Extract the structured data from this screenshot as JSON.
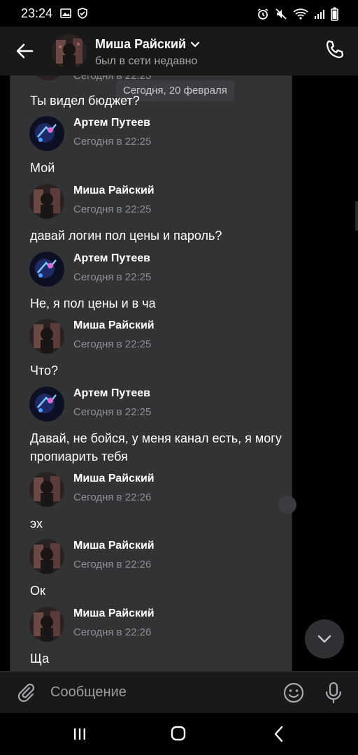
{
  "status_bar": {
    "time": "23:24"
  },
  "header": {
    "contact_name": "Миша Райский",
    "contact_status": "был в сети недавно"
  },
  "chat": {
    "date_chip": "Сегодня, 20 февраля",
    "partial_top_time": "Сегодня в 22:25",
    "messages": [
      {
        "text": "Ты видел бюджет?"
      },
      {
        "sender": "Артем Путеев",
        "time": "Сегодня в 22:25",
        "text": "Мой"
      },
      {
        "sender": "Миша Райский",
        "time": "Сегодня в 22:25",
        "text": "давай логин пол цены и пароль?"
      },
      {
        "sender": "Артем Путеев",
        "time": "Сегодня в 22:25",
        "text": "Не, я пол цены и в ча"
      },
      {
        "sender": "Миша Райский",
        "time": "Сегодня в 22:25",
        "text": "Что?"
      },
      {
        "sender": "Артем Путеев",
        "time": "Сегодня в 22:25",
        "text": "Давай, не бойся, у меня канал есть, я могу пропиарить тебя"
      },
      {
        "sender": "Миша Райский",
        "time": "Сегодня в 22:26",
        "text": "эх"
      },
      {
        "sender": "Миша Райский",
        "time": "Сегодня в 22:26",
        "text": "Ок"
      },
      {
        "sender": "Миша Райский",
        "time": "Сегодня в 22:26",
        "text": "Ща"
      }
    ]
  },
  "composer": {
    "placeholder": "Сообщение"
  },
  "icons": {
    "back": "arrow-left-icon",
    "call": "phone-icon",
    "attach": "paperclip-icon",
    "emoji": "smile-icon",
    "mic": "microphone-icon",
    "scroll_down": "chevron-down-icon"
  },
  "colors": {
    "background": "#000000",
    "header": "#19191a",
    "chat_panel": "#323335",
    "text": "#ffffff",
    "secondary_text": "#8c8f94"
  }
}
